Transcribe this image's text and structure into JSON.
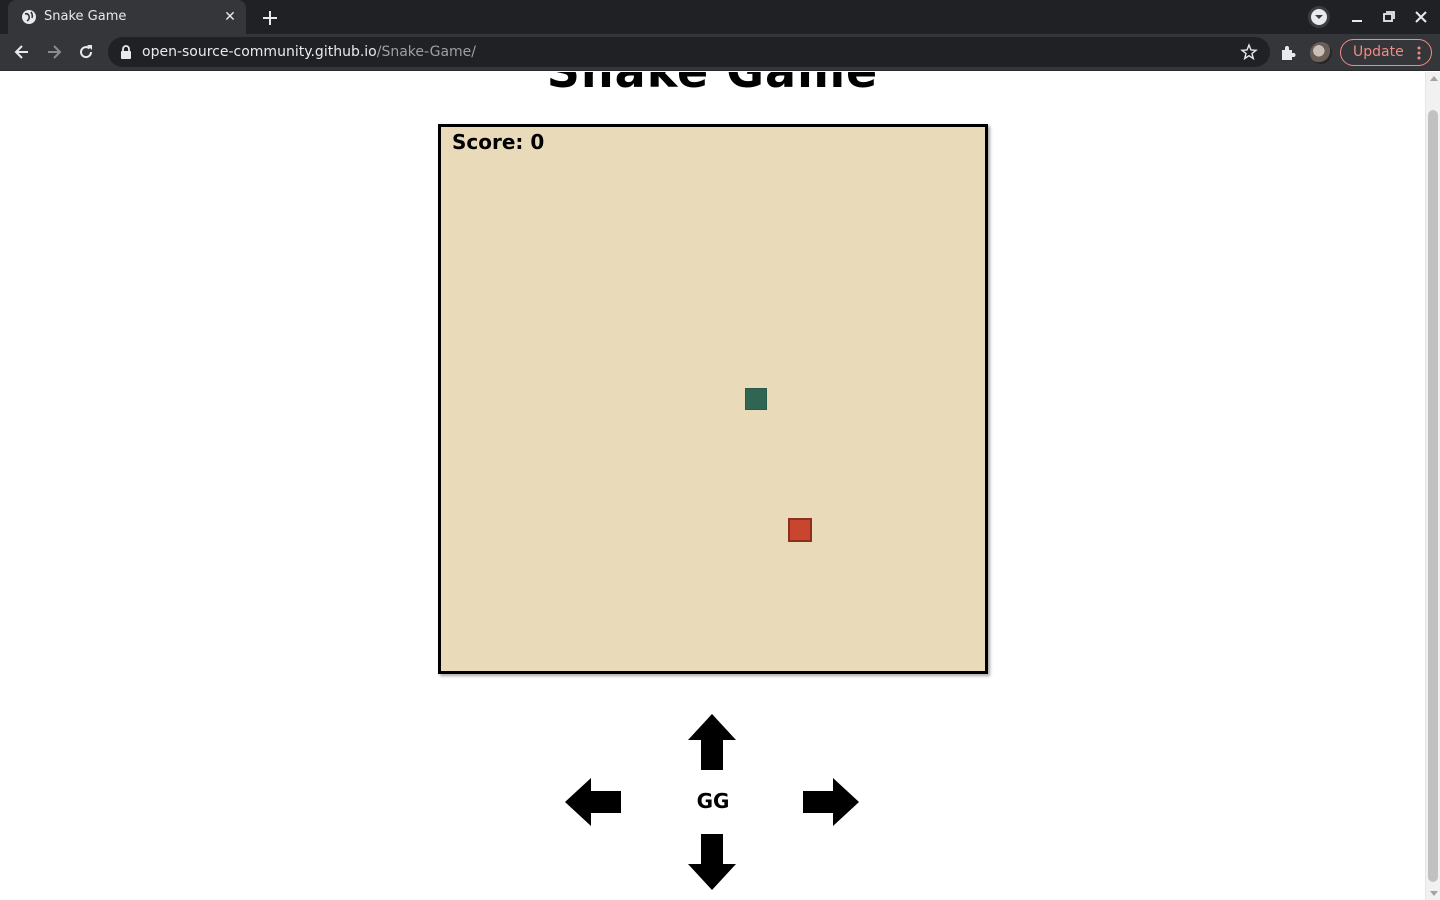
{
  "browser": {
    "tab_title": "Snake Game",
    "tab_close": "✕",
    "url_host": "open-source-community.github.io",
    "url_path": "/Snake-Game/",
    "update_label": "Update",
    "update_accent": "#f28b82"
  },
  "page": {
    "title": "Snake Game",
    "score_text": "Score: 0",
    "center_label": "GG",
    "board_color": "#e9dab9",
    "snake_color": "#2f6653",
    "food_color": "#c8462f"
  },
  "controls": {
    "icons": [
      "arrow-up-icon",
      "arrow-left-icon",
      "arrow-right-icon",
      "arrow-down-icon"
    ]
  }
}
